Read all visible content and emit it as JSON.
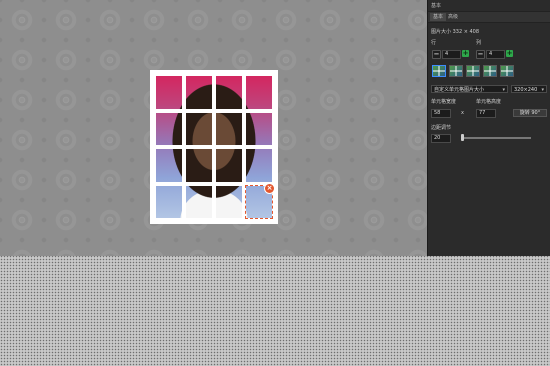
{
  "panel": {
    "title": "基本",
    "tabs": [
      "基本",
      "高级"
    ],
    "image_size_label": "图片大小 332 × 408",
    "row_label": "行",
    "col_label": "列",
    "rows_value": "4",
    "cols_value": "4",
    "cell_size_dropdown": "自定义单元格图片大小",
    "size_dropdown": "320×240",
    "cell_width_label": "单元格宽度",
    "cell_height_label": "单元格高度",
    "cell_width_value": "58",
    "cell_height_value": "77",
    "times_symbol": "x",
    "rotate_label": "旋转 90°",
    "margin_label": "边距调节",
    "margin_value": "20"
  },
  "controls": {
    "minus": "−",
    "plus": "+",
    "chevron": "▾",
    "remove": "×"
  },
  "photo_grid": {
    "rows": 4,
    "cols": 4
  },
  "colors": {
    "panel_bg": "#2b2b2b",
    "accent_green": "#2ea84b",
    "remove_badge": "#e4572e"
  }
}
